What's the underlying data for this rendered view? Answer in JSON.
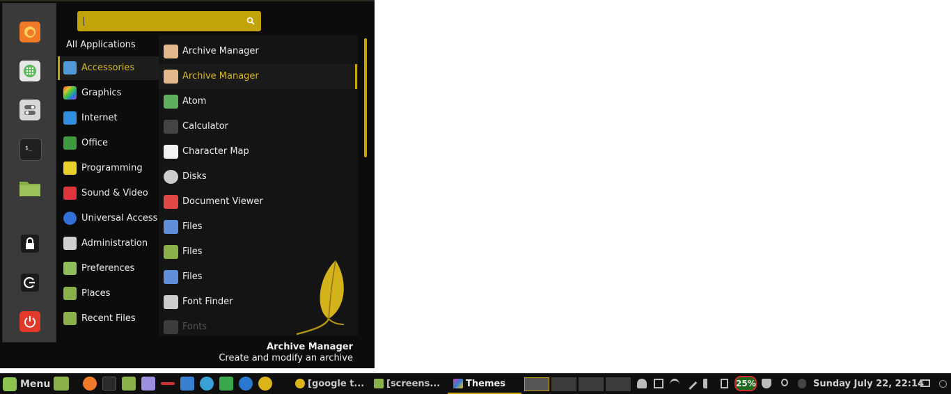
{
  "search": {
    "value": "",
    "icon": "search-icon"
  },
  "favorites": [
    {
      "name": "firefox",
      "icon": "firefox-icon",
      "color": "#f07a2a"
    },
    {
      "name": "software-manager",
      "icon": "grid-icon",
      "color": "#e8e8e8"
    },
    {
      "name": "system-settings",
      "icon": "toggles-icon",
      "color": "#d8d8d8"
    },
    {
      "name": "terminal",
      "icon": "terminal-icon",
      "color": "#202020"
    },
    {
      "name": "files",
      "icon": "folder-icon",
      "color": "#8ab04a"
    },
    {
      "name": "lock-screen",
      "icon": "lock-icon",
      "color": "#1a1a1a"
    },
    {
      "name": "logout",
      "icon": "logout-icon",
      "color": "#1a1a1a"
    },
    {
      "name": "shutdown",
      "icon": "power-icon",
      "color": "#e23a2a"
    }
  ],
  "categories": {
    "header": "All Applications",
    "items": [
      {
        "label": "Accessories",
        "icon": "scissors-icon",
        "color": "#4f9ad6",
        "active": true
      },
      {
        "label": "Graphics",
        "icon": "palette-icon",
        "color": "#c43ab8"
      },
      {
        "label": "Internet",
        "icon": "cloud-icon",
        "color": "#2f8ee0"
      },
      {
        "label": "Office",
        "icon": "document-icon",
        "color": "#3e9a3e"
      },
      {
        "label": "Programming",
        "icon": "ruler-icon",
        "color": "#e8d12a"
      },
      {
        "label": "Sound & Video",
        "icon": "play-icon",
        "color": "#e0343c"
      },
      {
        "label": "Universal Access",
        "icon": "accessibility-icon",
        "color": "#2f6fd6"
      },
      {
        "label": "Administration",
        "icon": "toggles-icon",
        "color": "#cfcfcf"
      },
      {
        "label": "Preferences",
        "icon": "toggles-icon",
        "color": "#8fbf5a"
      },
      {
        "label": "Places",
        "icon": "folder-icon",
        "color": "#8ab04a"
      },
      {
        "label": "Recent Files",
        "icon": "recent-folder-icon",
        "color": "#8ab04a"
      }
    ]
  },
  "apps": [
    {
      "label": "Archive Manager",
      "icon": "archive-icon",
      "color": "#e0b88a"
    },
    {
      "label": "Archive Manager",
      "icon": "archive-icon",
      "color": "#e0b88a",
      "active": true
    },
    {
      "label": "Atom",
      "icon": "atom-icon",
      "color": "#5fae5f"
    },
    {
      "label": "Calculator",
      "icon": "calculator-icon",
      "color": "#444444"
    },
    {
      "label": "Character Map",
      "icon": "character-map-icon",
      "color": "#f2f2f2"
    },
    {
      "label": "Disks",
      "icon": "disk-icon",
      "color": "#cccccc"
    },
    {
      "label": "Document Viewer",
      "icon": "glasses-icon",
      "color": "#e04848"
    },
    {
      "label": "Files",
      "icon": "cabinet-icon",
      "color": "#5f8fd8"
    },
    {
      "label": "Files",
      "icon": "folder-icon",
      "color": "#8ab04a"
    },
    {
      "label": "Files",
      "icon": "cabinet-icon",
      "color": "#5f8fd8"
    },
    {
      "label": "Font Finder",
      "icon": "font-icon",
      "color": "#cccccc"
    },
    {
      "label": "Fonts",
      "icon": "font-icon",
      "color": "#777777",
      "faded": true
    }
  ],
  "description": {
    "title": "Archive Manager",
    "text": "Create and modify an archive"
  },
  "taskbar": {
    "menu_label": "Menu",
    "launchers": [
      {
        "name": "files",
        "icon": "folder-icon",
        "color": "#8ab04a"
      },
      {
        "name": "firefox",
        "icon": "firefox-icon",
        "color": "#f07a2a"
      },
      {
        "name": "terminal",
        "icon": "terminal-icon",
        "color": "#2a2a2a"
      },
      {
        "name": "file-manager",
        "icon": "folder-icon",
        "color": "#8ab04a"
      },
      {
        "name": "text-editor",
        "icon": "text-icon",
        "color": "#9b8fe0"
      },
      {
        "name": "network-tool",
        "icon": "network-icon",
        "color": "#d03030"
      },
      {
        "name": "office-writer",
        "icon": "document-icon",
        "color": "#3a7fd0"
      },
      {
        "name": "camera",
        "icon": "shutter-icon",
        "color": "#3aa0d8"
      },
      {
        "name": "virtualbox",
        "icon": "cube-icon",
        "color": "#3aa84a"
      },
      {
        "name": "app-s",
        "icon": "s-icon",
        "color": "#2a78d0"
      },
      {
        "name": "chrome",
        "icon": "chrome-icon",
        "color": "#dbb31a"
      }
    ],
    "windows": [
      {
        "title": "[google t...",
        "icon": "chrome-icon",
        "color": "#dbb31a"
      },
      {
        "title": "[screens...",
        "icon": "folder-icon",
        "color": "#8ab04a"
      },
      {
        "title": "Themes",
        "icon": "themes-icon",
        "color": "#c43ab8",
        "active": true
      }
    ],
    "battery": "25%",
    "clock": "Sunday July 22, 22:14",
    "tray": [
      "user-icon",
      "screenshot-icon",
      "wifi-icon",
      "pen-icon",
      "volume-icon",
      "clipboard-icon",
      "battery-icon",
      "shield-icon",
      "bulb-icon",
      "bluetooth-icon",
      "display-icon",
      "power-icon"
    ],
    "accent": "#c2a40a"
  }
}
